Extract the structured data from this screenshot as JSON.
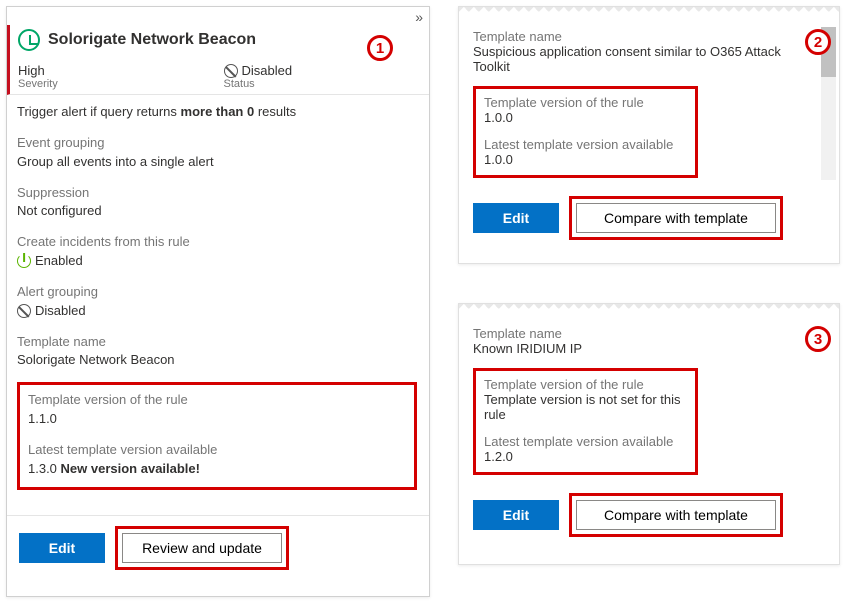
{
  "callouts": {
    "one": "1",
    "two": "2",
    "three": "3"
  },
  "panel1": {
    "title": "Solorigate Network Beacon",
    "severity": {
      "label": "Severity",
      "value": "High"
    },
    "status": {
      "label": "Status",
      "value": "Disabled"
    },
    "trigger": {
      "prefix": "Trigger alert if query returns ",
      "bold1": "more than 0",
      "suffix": " results"
    },
    "sections": {
      "eventGrouping": {
        "label": "Event grouping",
        "value": "Group all events into a single alert"
      },
      "suppression": {
        "label": "Suppression",
        "value": "Not configured"
      },
      "createIncidents": {
        "label": "Create incidents from this rule",
        "value": "Enabled"
      },
      "alertGrouping": {
        "label": "Alert grouping",
        "value": "Disabled"
      },
      "templateName": {
        "label": "Template name",
        "value": "Solorigate Network Beacon"
      }
    },
    "versionBox": {
      "ruleLabel": "Template version of the rule",
      "ruleValue": "1.1.0",
      "latestLabel": "Latest template version available",
      "latestValuePrefix": "1.3.0 ",
      "latestValueBold": "New version available!"
    },
    "buttons": {
      "edit": "Edit",
      "review": "Review and update"
    }
  },
  "panel2": {
    "templateNameLabel": "Template name",
    "templateNameValue": "Suspicious application consent similar to O365 Attack Toolkit",
    "versionBox": {
      "ruleLabel": "Template version of the rule",
      "ruleValue": "1.0.0",
      "latestLabel": "Latest template version available",
      "latestValue": "1.0.0"
    },
    "buttons": {
      "edit": "Edit",
      "compare": "Compare with template"
    }
  },
  "panel3": {
    "templateNameLabel": "Template name",
    "templateNameValue": "Known IRIDIUM IP",
    "versionBox": {
      "ruleLabel": "Template version of the rule",
      "ruleValue": "Template version is not set for this rule",
      "latestLabel": "Latest template version available",
      "latestValue": "1.2.0"
    },
    "buttons": {
      "edit": "Edit",
      "compare": "Compare with template"
    }
  }
}
